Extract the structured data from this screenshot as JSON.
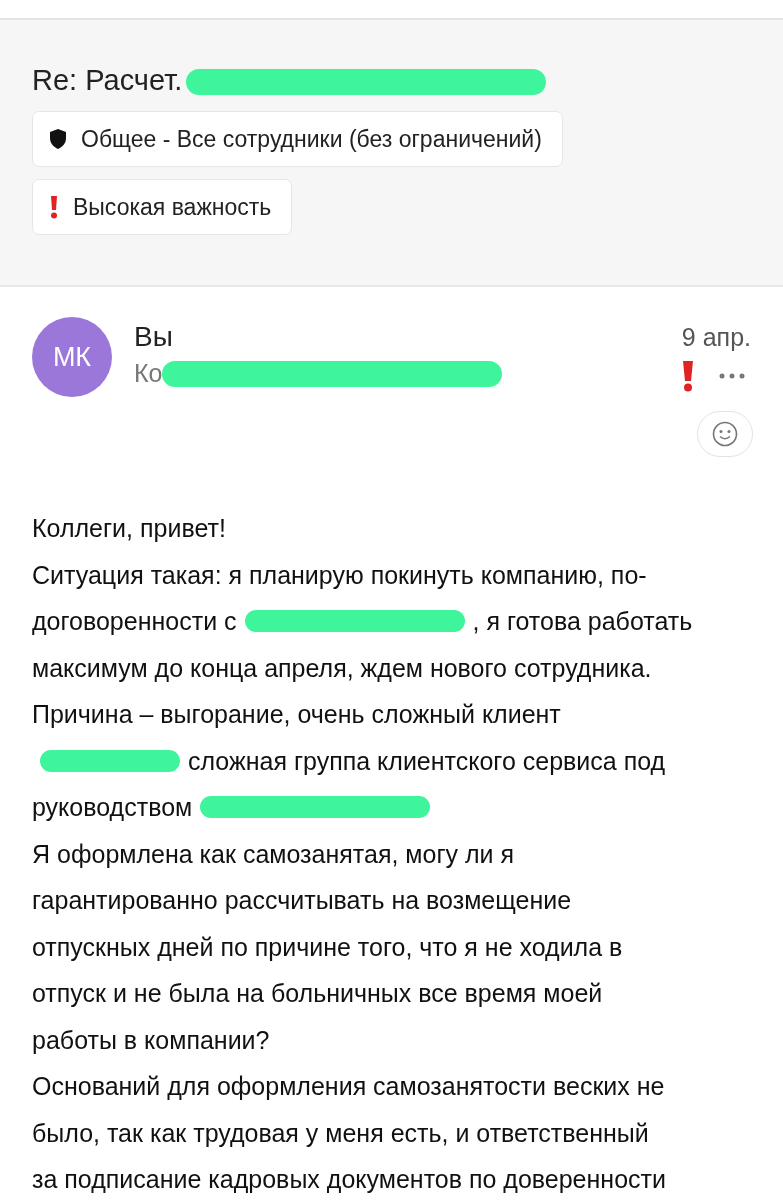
{
  "subject": {
    "text": "Re: Расчет.",
    "redacted": true
  },
  "labels": [
    {
      "kind": "classification",
      "label": "Общее - Все сотрудники (без ограничений)"
    },
    {
      "kind": "importance",
      "label": "Высокая важность"
    }
  ],
  "message": {
    "avatar": "МК",
    "sender": "Вы",
    "to_prefix": "Ко",
    "to_redacted": true,
    "date": "9 апр.",
    "important": true,
    "lines": [
      [
        {
          "kind": "text",
          "text": "Коллеги, привет!"
        }
      ],
      [
        {
          "kind": "text",
          "text": "Ситуация такая: я планирую покинуть компанию, по-"
        }
      ],
      [
        {
          "kind": "text",
          "text": "договоренности с"
        },
        {
          "kind": "redaction"
        },
        {
          "kind": "text",
          "text": ", я готова работать"
        }
      ],
      [
        {
          "kind": "text",
          "text": "максимум до конца апреля, ждем нового сотрудника."
        }
      ],
      [
        {
          "kind": "text",
          "text": "Причина – выгорание, очень сложный клиент"
        }
      ],
      [
        {
          "kind": "redaction"
        },
        {
          "kind": "text",
          "text": "сложная группа клиентского сервиса под"
        }
      ],
      [
        {
          "kind": "text",
          "text": "руководством"
        },
        {
          "kind": "redaction"
        }
      ],
      [
        {
          "kind": "text",
          "text": "Я оформлена как самозанятая, могу ли я"
        }
      ],
      [
        {
          "kind": "text",
          "text": "гарантированно рассчитывать на возмещение"
        }
      ],
      [
        {
          "kind": "text",
          "text": "отпускных дней по причине того, что я не ходила в"
        }
      ],
      [
        {
          "kind": "text",
          "text": "отпуск и не была на больничных все время моей"
        }
      ],
      [
        {
          "kind": "text",
          "text": "работы в компании?"
        }
      ],
      [
        {
          "kind": "text",
          "text": "Оснований для оформления самозанятости веских не"
        }
      ],
      [
        {
          "kind": "text",
          "text": "было, так как трудовая у меня есть, и ответственный"
        }
      ],
      [
        {
          "kind": "text",
          "text": "за подписание кадровых документов по доверенности"
        }
      ]
    ]
  }
}
